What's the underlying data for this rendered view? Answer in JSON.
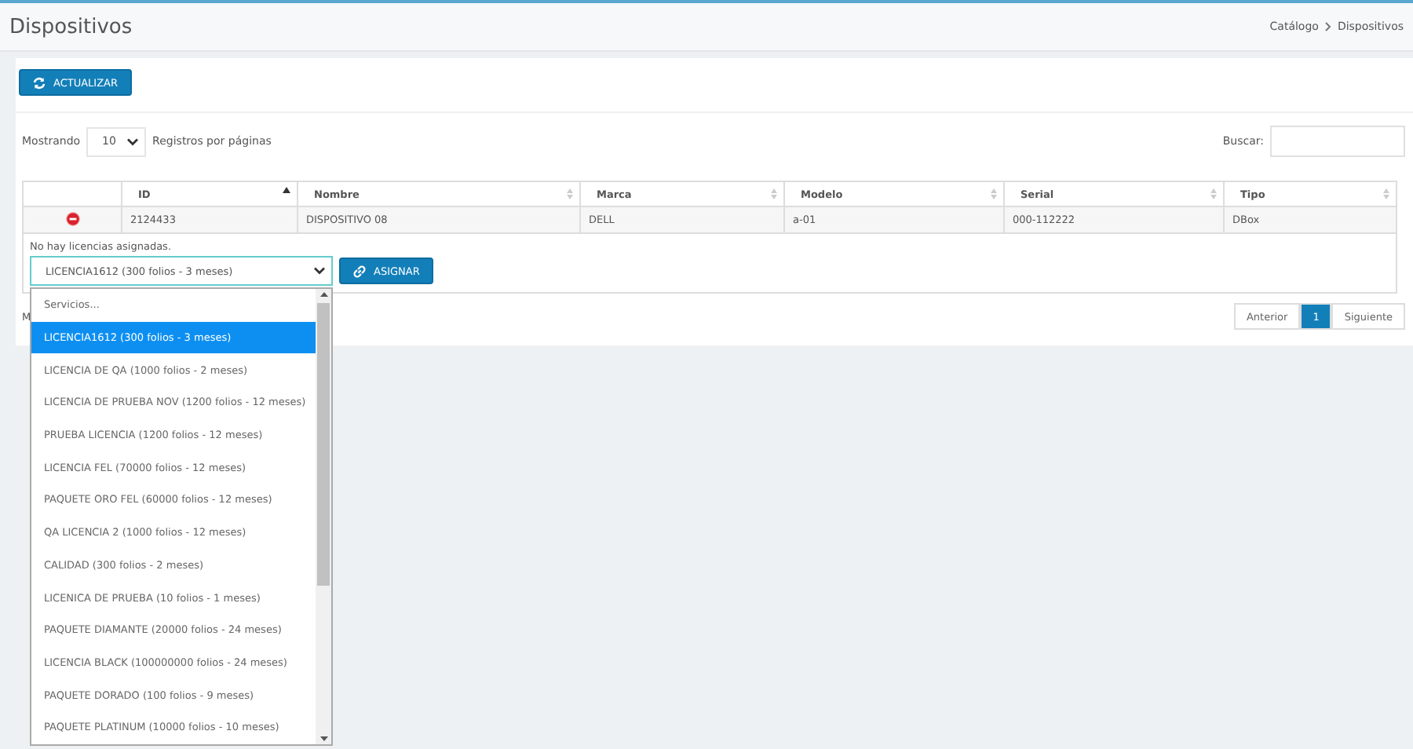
{
  "page_title": "Dispositivos",
  "breadcrumb": [
    "Catálogo",
    "Dispositivos"
  ],
  "refresh_button": "ACTUALIZAR",
  "length": {
    "prefix": "Mostrando",
    "value": "10",
    "suffix": "Registros por páginas"
  },
  "search": {
    "label": "Buscar:"
  },
  "table": {
    "columns": [
      {
        "label": "ID",
        "sorted": true
      },
      {
        "label": "Nombre",
        "sorted": false
      },
      {
        "label": "Marca",
        "sorted": false
      },
      {
        "label": "Modelo",
        "sorted": false
      },
      {
        "label": "Serial",
        "sorted": false
      },
      {
        "label": "Tipo",
        "sorted": false
      }
    ],
    "rows": [
      {
        "expanded": true,
        "cells": [
          "2124433",
          "DISPOSITIVO 08",
          "DELL",
          "a-01",
          "000-112222",
          "DBox"
        ],
        "detail": {
          "message": "No hay licencias asignadas.",
          "select_value": "LICENCIA1612 (300 folios - 3 meses)",
          "assign_button": "ASIGNAR"
        }
      }
    ]
  },
  "info_text": "M",
  "pagination": [
    {
      "label": "Anterior",
      "selected": false
    },
    {
      "label": "1",
      "selected": true
    },
    {
      "label": "Siguiente",
      "selected": false
    }
  ],
  "dropdown": {
    "options": [
      {
        "label": "Servicios...",
        "selected": false
      },
      {
        "label": "LICENCIA1612 (300 folios - 3 meses)",
        "selected": true
      },
      {
        "label": "LICENCIA DE QA (1000 folios - 2 meses)",
        "selected": false
      },
      {
        "label": "LICENCIA DE PRUEBA NOV (1200 folios - 12 meses)",
        "selected": false
      },
      {
        "label": "PRUEBA LICENCIA (1200 folios - 12 meses)",
        "selected": false
      },
      {
        "label": "LICENCIA FEL (70000 folios - 12 meses)",
        "selected": false
      },
      {
        "label": "PAQUETE ORO FEL (60000 folios - 12 meses)",
        "selected": false
      },
      {
        "label": "QA LICENCIA 2 (1000 folios - 12 meses)",
        "selected": false
      },
      {
        "label": "CALIDAD (300 folios - 2 meses)",
        "selected": false
      },
      {
        "label": "LICENICA DE PRUEBA (10 folios - 1 meses)",
        "selected": false
      },
      {
        "label": "PAQUETE DIAMANTE (20000 folios - 24 meses)",
        "selected": false
      },
      {
        "label": "LICENCIA BLACK (100000000 folios - 24 meses)",
        "selected": false
      },
      {
        "label": "PAQUETE DORADO (100 folios - 9 meses)",
        "selected": false
      },
      {
        "label": "PAQUETE PLATINUM (10000 folios - 10 meses)",
        "selected": false
      }
    ]
  }
}
